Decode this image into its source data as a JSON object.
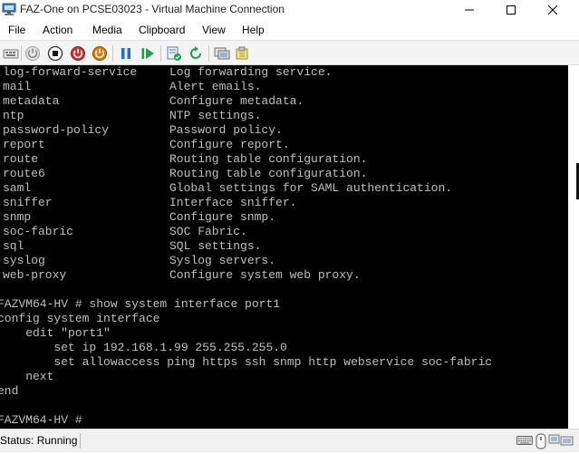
{
  "window": {
    "title": "FAZ-One on PCSE03023 - Virtual Machine Connection"
  },
  "menu": [
    "File",
    "Action",
    "Media",
    "Clipboard",
    "View",
    "Help"
  ],
  "console": {
    "config_list": [
      {
        "name": "log-forward-service",
        "desc": "Log forwarding service."
      },
      {
        "name": "mail",
        "desc": "Alert emails."
      },
      {
        "name": "metadata",
        "desc": "Configure metadata."
      },
      {
        "name": "ntp",
        "desc": "NTP settings."
      },
      {
        "name": "password-policy",
        "desc": "Password policy."
      },
      {
        "name": "report",
        "desc": "Configure report."
      },
      {
        "name": "route",
        "desc": "Routing table configuration."
      },
      {
        "name": "route6",
        "desc": "Routing table configuration."
      },
      {
        "name": "saml",
        "desc": "Global settings for SAML authentication."
      },
      {
        "name": "sniffer",
        "desc": "Interface sniffer."
      },
      {
        "name": "snmp",
        "desc": "Configure snmp."
      },
      {
        "name": "soc-fabric",
        "desc": "SOC Fabric."
      },
      {
        "name": "sql",
        "desc": "SQL settings."
      },
      {
        "name": "syslog",
        "desc": "Syslog servers."
      },
      {
        "name": "web-proxy",
        "desc": "Configure system web proxy."
      }
    ],
    "prompt_command": "FAZVM64-HV # show system interface port1",
    "output": [
      "config system interface",
      "    edit \"port1\"",
      "        set ip 192.168.1.99 255.255.255.0",
      "        set allowaccess ping https ssh snmp http webservice soc-fabric",
      "    next",
      "end"
    ],
    "final_prompt": "FAZVM64-HV #"
  },
  "status": {
    "label": "Status: Running"
  },
  "colors": {
    "console_bg": "#000000",
    "console_text": "#bfbfbf",
    "pause_blue": "#1e6fd9",
    "play_green": "#1aa34a",
    "stop_red": "#d32f2f",
    "power_orange": "#e07b00"
  }
}
